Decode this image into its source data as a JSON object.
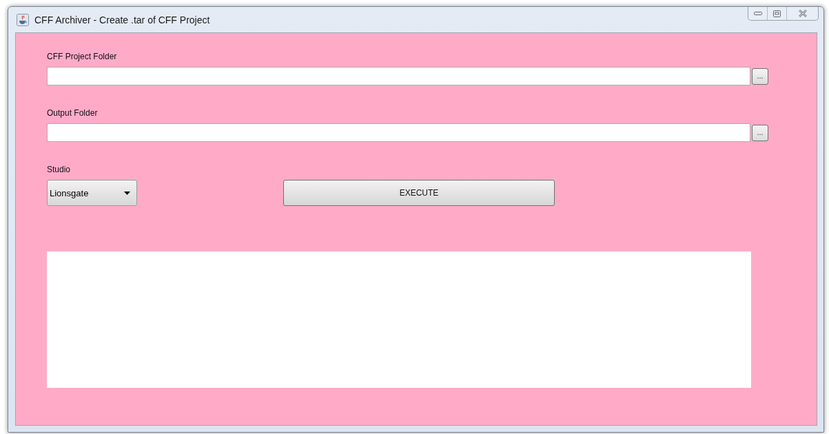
{
  "window": {
    "title": "CFF Archiver - Create .tar of CFF Project"
  },
  "fields": [
    {
      "label": "CFF Project Folder",
      "browse": "..."
    },
    {
      "label": "Output Folder",
      "browse": "..."
    }
  ],
  "studio": {
    "label": "Studio",
    "value": "Lionsgate"
  },
  "execute_button": "EXECUTE"
}
